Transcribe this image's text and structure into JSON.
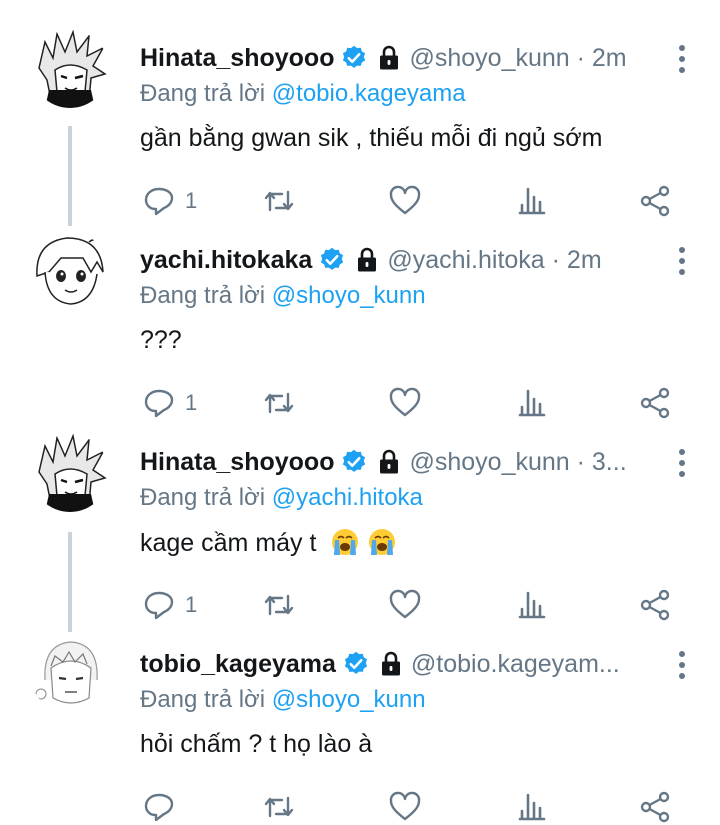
{
  "reply_prefix": "Đang trả lời",
  "tweets": [
    {
      "name": "Hinata_shoyooo",
      "handle": "@shoyo_kunn · 2m",
      "reply_to": "@tobio.kageyama",
      "text": "gần bằng gwan sik , thiếu mỗi đi ngủ sớm",
      "reply_count": "1",
      "avatar": "hinata-avatar"
    },
    {
      "name": "yachi.hitokaka",
      "handle": "@yachi.hitoka · 2m",
      "reply_to": "@shoyo_kunn",
      "text": "???",
      "reply_count": "1",
      "avatar": "yachi-avatar"
    },
    {
      "name": "Hinata_shoyooo",
      "handle": "@shoyo_kunn · 3...",
      "reply_to": "@yachi.hitoka",
      "text": "kage cầm máy t",
      "emojis": [
        "loudly-crying-face",
        "loudly-crying-face"
      ],
      "reply_count": "1",
      "avatar": "hinata-avatar"
    },
    {
      "name": "tobio_kageyama",
      "handle": "@tobio.kageyam...",
      "reply_to": "@shoyo_kunn",
      "text": "hỏi chấm ? t họ lào à",
      "reply_count": "",
      "avatar": "kageyama-avatar"
    }
  ],
  "icons": {
    "verified": "verified-badge-icon",
    "lock": "protected-lock-icon",
    "more": "more-vertical-icon",
    "reply": "reply-icon",
    "retweet": "retweet-icon",
    "like": "like-heart-icon",
    "stats": "analytics-icon",
    "share": "share-icon"
  },
  "colors": {
    "accent": "#1da1f2",
    "secondary_text": "#657786",
    "thread_line": "#c9d3db"
  }
}
